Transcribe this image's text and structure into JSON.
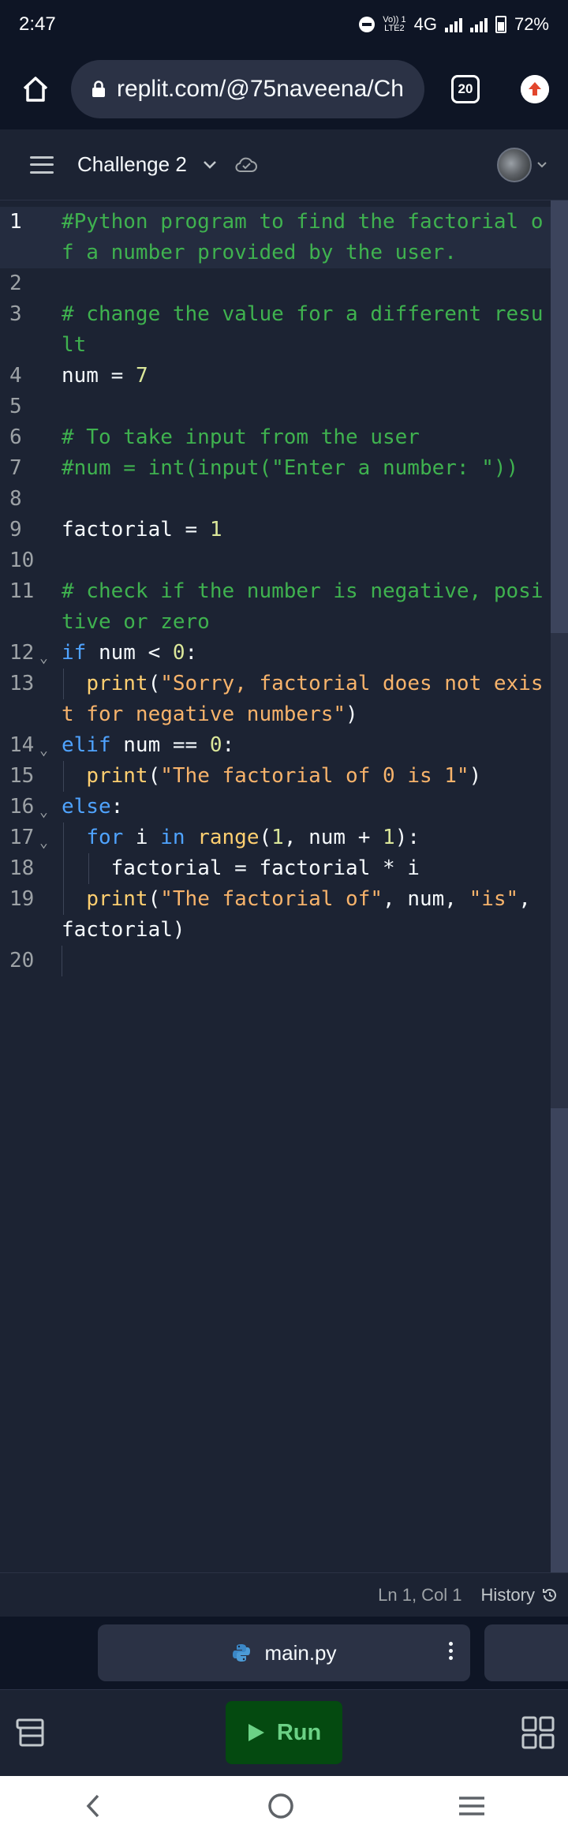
{
  "status_bar": {
    "time": "2:47",
    "network_top": "Vo)) 1",
    "network_bottom": "LTE2",
    "network_type": "4G",
    "battery": "72%"
  },
  "browser": {
    "url": "replit.com/@75naveena/Ch",
    "tab_count": "20"
  },
  "header": {
    "repl_name": "Challenge 2"
  },
  "editor": {
    "lines": [
      {
        "n": "1"
      },
      {
        "n": "2"
      },
      {
        "n": "3"
      },
      {
        "n": "4"
      },
      {
        "n": "5"
      },
      {
        "n": "6"
      },
      {
        "n": "7"
      },
      {
        "n": "8"
      },
      {
        "n": "9"
      },
      {
        "n": "10"
      },
      {
        "n": "11"
      },
      {
        "n": "12"
      },
      {
        "n": "13"
      },
      {
        "n": "14"
      },
      {
        "n": "15"
      },
      {
        "n": "16"
      },
      {
        "n": "17"
      },
      {
        "n": "18"
      },
      {
        "n": "19"
      },
      {
        "n": "20"
      }
    ],
    "code": {
      "l1": "#Python program to find the factorial of a number provided by the user.",
      "l3": "# change the value for a different result",
      "l4a": "num",
      "l4b": " = ",
      "l4c": "7",
      "l6": "# To take input from the user",
      "l7": "#num = int(input(\"Enter a number: \"))",
      "l9a": "factorial",
      "l9b": " = ",
      "l9c": "1",
      "l11": "# check if the number is negative, positive or zero",
      "l12a": "if",
      "l12b": " num < ",
      "l12c": "0",
      "l12d": ":",
      "l13a": "print",
      "l13b": "(",
      "l13c": "\"Sorry, factorial does not exist for negative numbers\"",
      "l13d": ")",
      "l14a": "elif",
      "l14b": " num == ",
      "l14c": "0",
      "l14d": ":",
      "l15a": "print",
      "l15b": "(",
      "l15c": "\"The factorial of 0 is 1\"",
      "l15d": ")",
      "l16a": "else",
      "l16b": ":",
      "l17a": "for",
      "l17b": " i ",
      "l17c": "in",
      "l17d": " ",
      "l17e": "range",
      "l17f": "(",
      "l17g": "1",
      "l17h": ", num + ",
      "l17i": "1",
      "l17j": "):",
      "l18": "factorial = factorial * i",
      "l19a": "print",
      "l19b": "(",
      "l19c": "\"The factorial of\"",
      "l19d": ", num, ",
      "l19e": "\"is\"",
      "l19f": ", factorial)"
    }
  },
  "status_line": {
    "cursor": "Ln 1, Col 1",
    "history": "History"
  },
  "file_tabs": {
    "active": "main.py"
  },
  "toolbar": {
    "run_label": "Run"
  },
  "colors": {
    "background": "#1c2333",
    "chrome": "#0e1525",
    "comment": "#3fb24f",
    "keyword": "#4fa3ff",
    "string": "#f7b36b",
    "number": "#dbe79a",
    "run_button": "#044a10"
  },
  "icons": [
    "home-icon",
    "lock-icon",
    "tabs-icon",
    "update-icon",
    "menu-icon",
    "chevron-down-icon",
    "cloud-check-icon",
    "history-icon",
    "python-icon",
    "more-vertical-icon",
    "layers-icon",
    "play-icon",
    "grid-icon",
    "back-icon",
    "home-circle-icon",
    "recents-icon"
  ]
}
